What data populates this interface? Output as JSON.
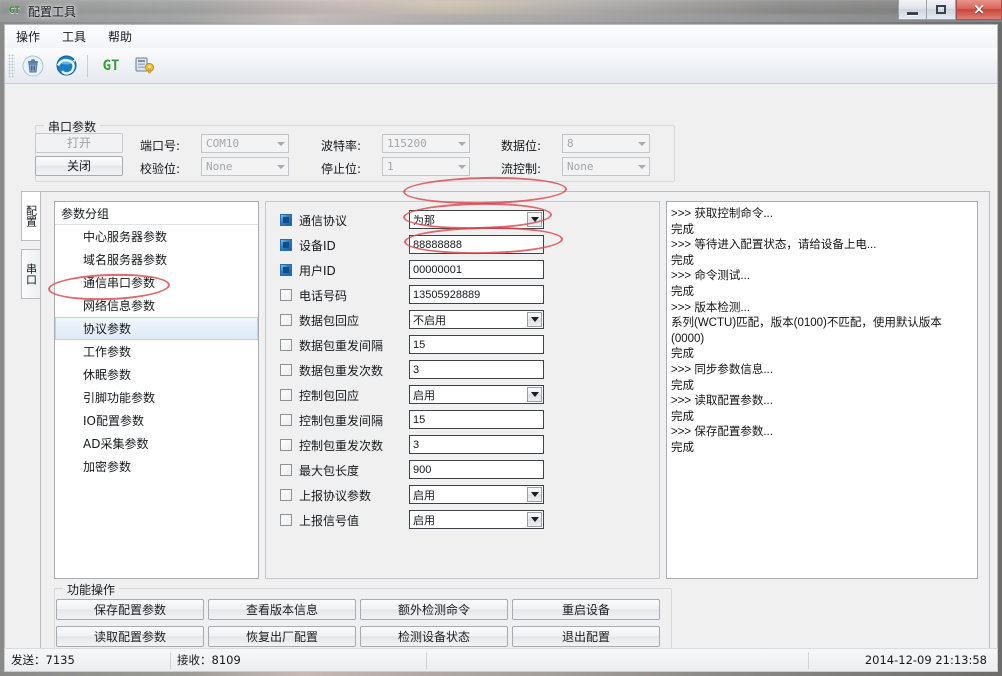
{
  "window": {
    "title": "配置工具",
    "icon": "GT",
    "controls": {
      "minimize": "minimize-icon",
      "maximize": "maximize-icon",
      "close": "×"
    }
  },
  "menubar": {
    "items": [
      "操作",
      "工具",
      "帮助"
    ]
  },
  "toolbar": {
    "buttons": [
      {
        "name": "trash-icon",
        "label": ""
      },
      {
        "name": "globe-icon",
        "label": ""
      },
      {
        "name": "gt-icon",
        "label": "GT"
      },
      {
        "name": "device-key-icon",
        "label": ""
      }
    ]
  },
  "serial": {
    "title": "串口参数",
    "open_button": "打开",
    "close_button": "关闭",
    "fields": [
      {
        "label": "端口号:",
        "value": "COM10"
      },
      {
        "label": "波特率:",
        "value": "115200"
      },
      {
        "label": "数据位:",
        "value": "8"
      },
      {
        "label": "校验位:",
        "value": "None"
      },
      {
        "label": "停止位:",
        "value": "1"
      },
      {
        "label": "流控制:",
        "value": "None"
      }
    ]
  },
  "vtabs": [
    {
      "label": "配置",
      "active": true
    },
    {
      "label": "串口",
      "active": false
    }
  ],
  "grouplist": {
    "header": "参数分组",
    "items": [
      {
        "label": "中心服务器参数",
        "selected": false
      },
      {
        "label": "域名服务器参数",
        "selected": false
      },
      {
        "label": "通信串口参数",
        "selected": false
      },
      {
        "label": "网络信息参数",
        "selected": false
      },
      {
        "label": "协议参数",
        "selected": true
      },
      {
        "label": "工作参数",
        "selected": false
      },
      {
        "label": "休眠参数",
        "selected": false
      },
      {
        "label": "引脚功能参数",
        "selected": false
      },
      {
        "label": "IO配置参数",
        "selected": false
      },
      {
        "label": "AD采集参数",
        "selected": false
      },
      {
        "label": "加密参数",
        "selected": false
      }
    ]
  },
  "params": [
    {
      "label": "通信协议",
      "checked": true,
      "value": "为那",
      "type": "combo"
    },
    {
      "label": "设备ID",
      "checked": true,
      "value": "88888888",
      "type": "text"
    },
    {
      "label": "用户ID",
      "checked": true,
      "value": "00000001",
      "type": "text"
    },
    {
      "label": "电话号码",
      "checked": false,
      "value": "13505928889",
      "type": "text"
    },
    {
      "label": "数据包回应",
      "checked": false,
      "value": "不启用",
      "type": "combo"
    },
    {
      "label": "数据包重发间隔",
      "checked": false,
      "value": "15",
      "type": "text"
    },
    {
      "label": "数据包重发次数",
      "checked": false,
      "value": "3",
      "type": "text"
    },
    {
      "label": "控制包回应",
      "checked": false,
      "value": "启用",
      "type": "combo"
    },
    {
      "label": "控制包重发间隔",
      "checked": false,
      "value": "15",
      "type": "text"
    },
    {
      "label": "控制包重发次数",
      "checked": false,
      "value": "3",
      "type": "text"
    },
    {
      "label": "最大包长度",
      "checked": false,
      "value": "900",
      "type": "text"
    },
    {
      "label": "上报协议参数",
      "checked": false,
      "value": "启用",
      "type": "combo"
    },
    {
      "label": "上报信号值",
      "checked": false,
      "value": "启用",
      "type": "combo"
    }
  ],
  "log": {
    "lines": [
      ">>> 获取控制命令...",
      "完成",
      ">>> 等待进入配置状态，请给设备上电...",
      "完成",
      ">>> 命令测试...",
      "完成",
      ">>> 版本检测...",
      "系列(WCTU)匹配，版本(0100)不匹配，使用默认版本(0000)",
      "完成",
      ">>> 同步参数信息...",
      "完成",
      ">>> 读取配置参数...",
      "完成",
      ">>> 保存配置参数...",
      "完成"
    ]
  },
  "functions": {
    "title": "功能操作",
    "buttons": [
      "保存配置参数",
      "查看版本信息",
      "额外检测命令",
      "重启设备",
      "读取配置参数",
      "恢复出厂配置",
      "检测设备状态",
      "退出配置"
    ]
  },
  "statusbar": {
    "sent": "发送：7135",
    "received": "接收：8109",
    "datetime": "2014-12-09 21:13:58"
  },
  "accent": {
    "annotation": "#d8484e",
    "selection": "#dfeaf7",
    "checkbox": "#1b5d9e"
  }
}
